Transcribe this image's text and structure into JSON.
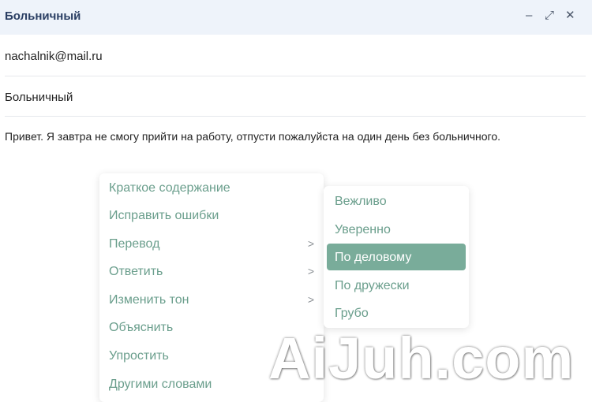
{
  "window": {
    "title": "Больничный",
    "controls": {
      "minimize": "–",
      "expand": "⤢",
      "close": "✕"
    }
  },
  "email": {
    "to": "nachalnik@mail.ru",
    "subject": "Больничный",
    "body": "Привет. Я завтра не смогу прийти на работу, отпусти пожалуйста на один день без больничного."
  },
  "context_menu": {
    "items": [
      {
        "label": "Краткое содержание",
        "submenu": ""
      },
      {
        "label": "Исправить ошибки",
        "submenu": ""
      },
      {
        "label": "Перевод",
        "submenu": ">"
      },
      {
        "label": "Ответить",
        "submenu": ">"
      },
      {
        "label": "Изменить тон",
        "submenu": ">"
      },
      {
        "label": "Объяснить",
        "submenu": ""
      },
      {
        "label": "Упростить",
        "submenu": ""
      },
      {
        "label": "Другими словами",
        "submenu": ""
      }
    ]
  },
  "tone_submenu": {
    "items": [
      {
        "label": "Вежливо"
      },
      {
        "label": "Уверенно"
      },
      {
        "label": "По деловому"
      },
      {
        "label": "По дружески"
      },
      {
        "label": "Грубо"
      }
    ],
    "selected": "По деловому"
  },
  "watermark": "AiJuh.com",
  "colors": {
    "menu_text": "#6a9e8c",
    "selected_bg": "#79ac9a",
    "title_bar": "#eef3fa"
  }
}
